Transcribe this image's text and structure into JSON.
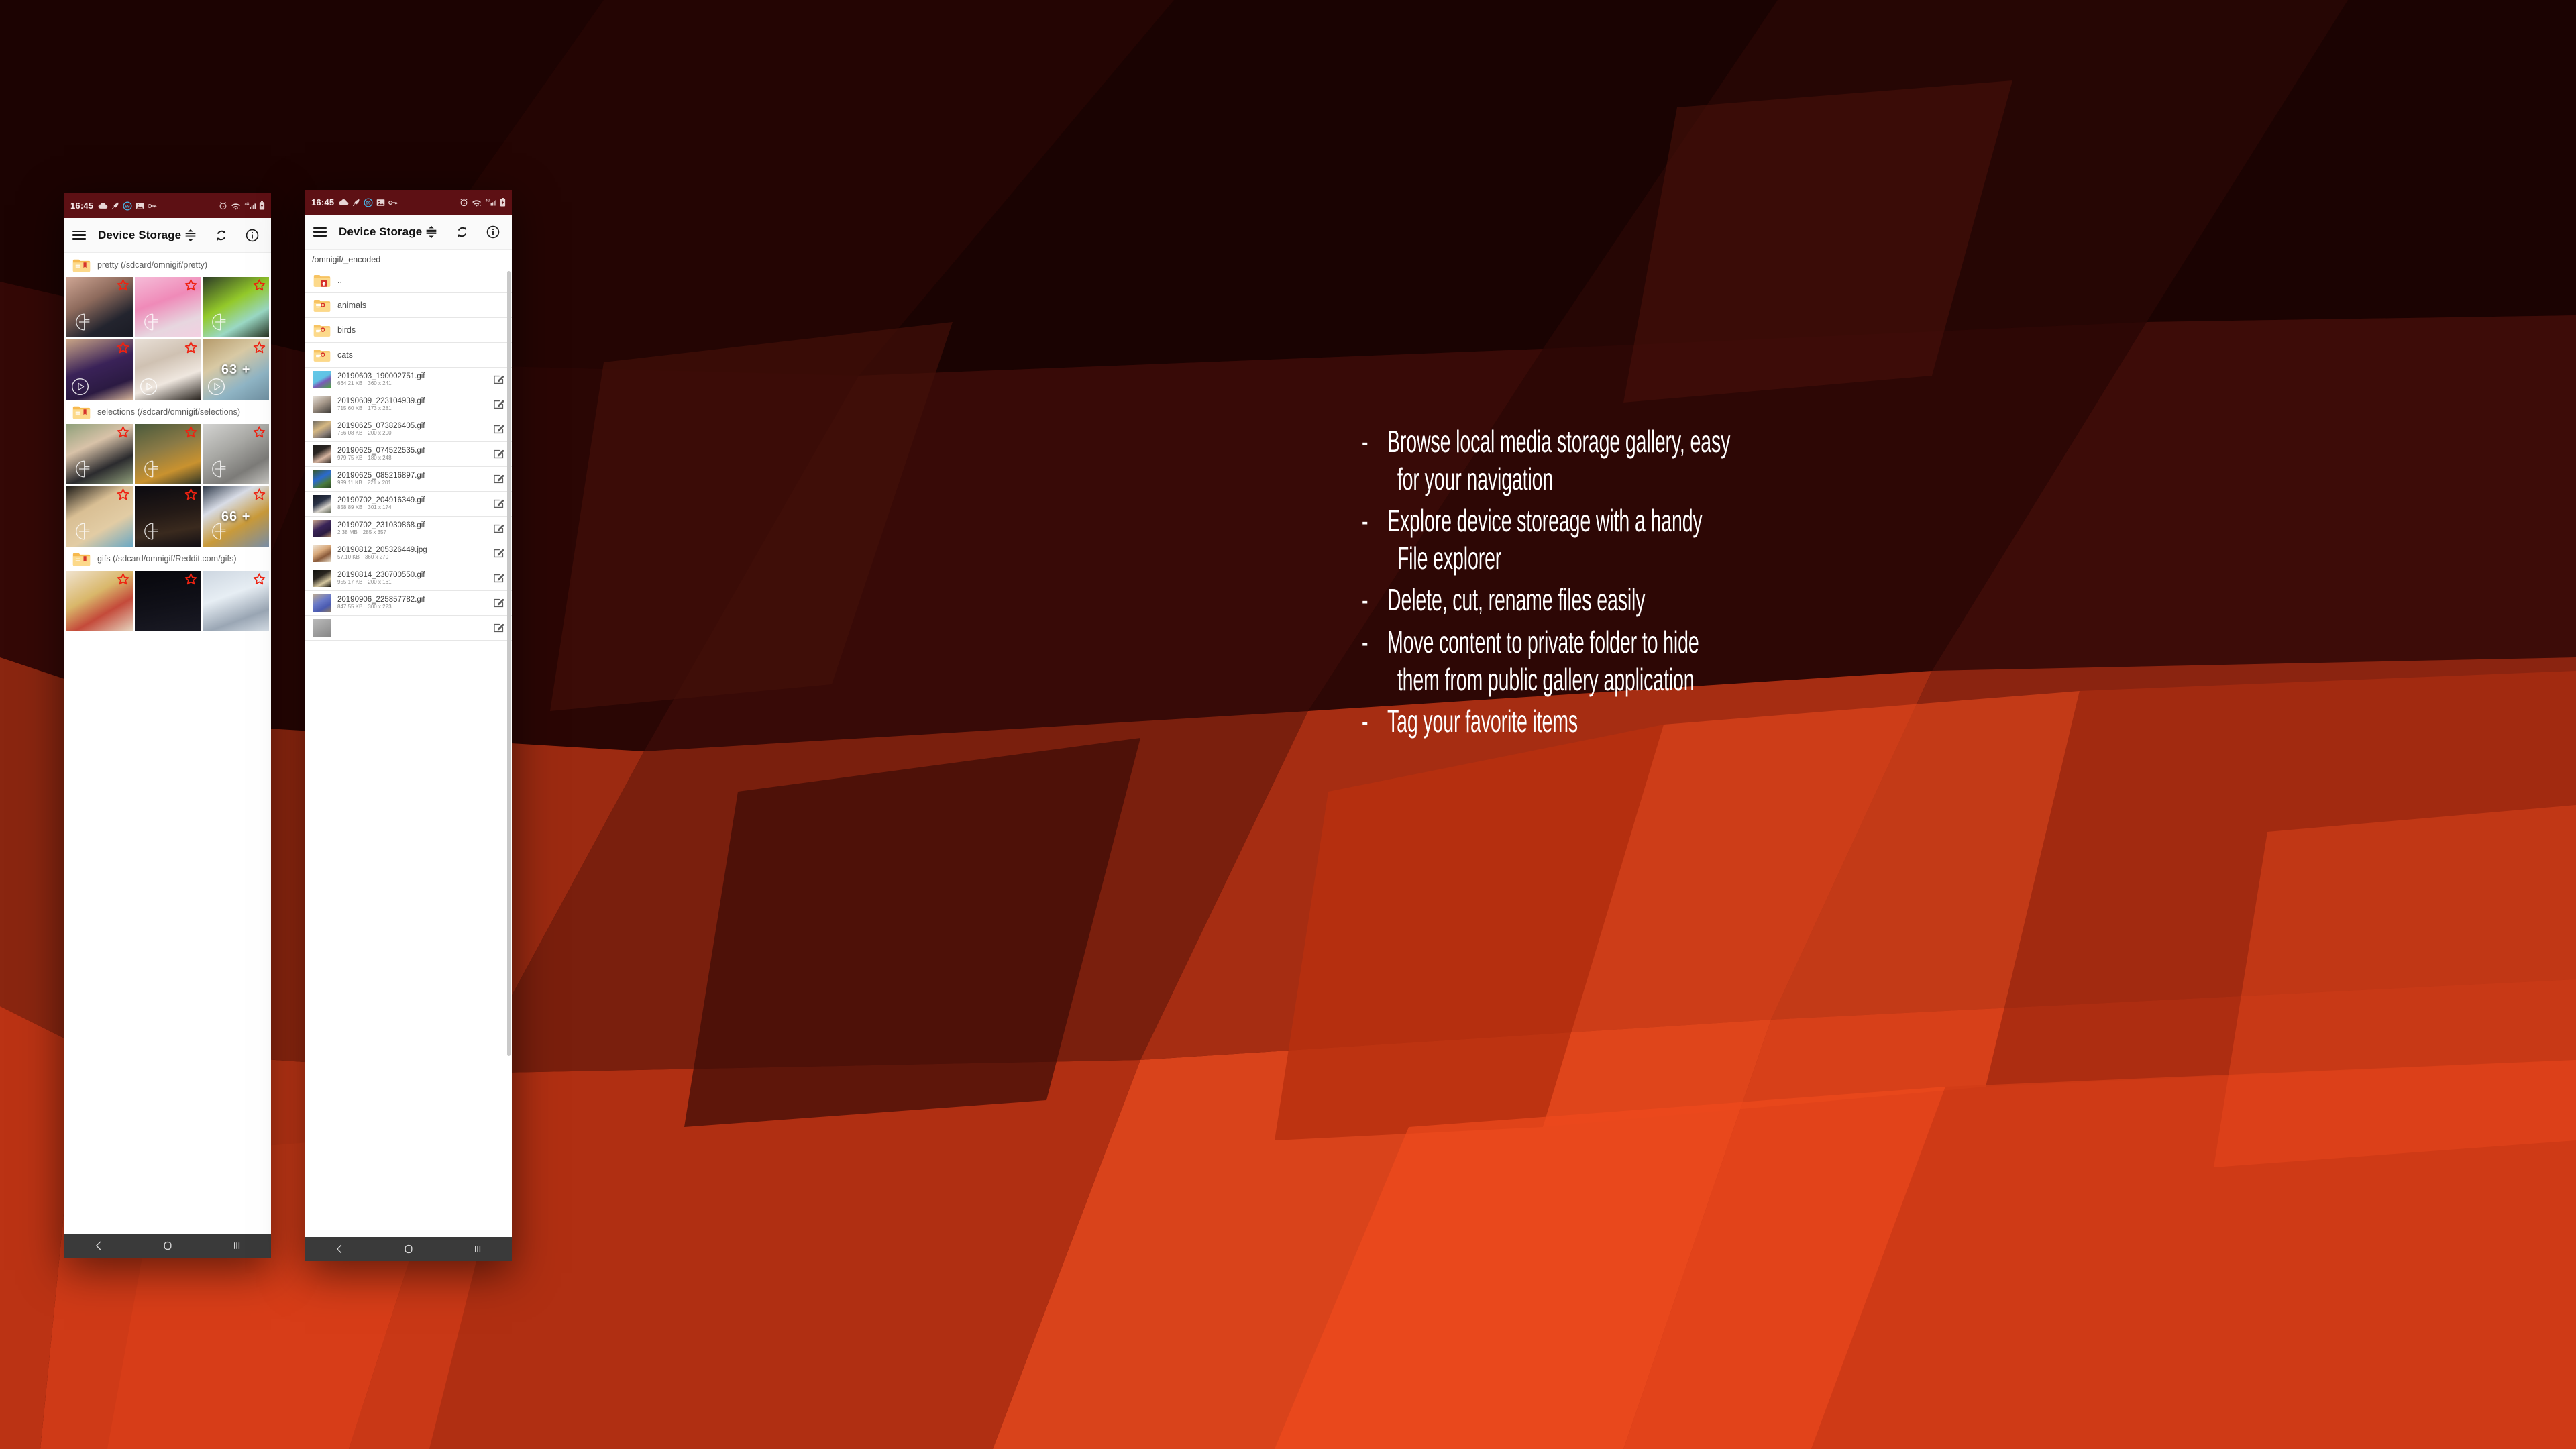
{
  "theme": {
    "statusbar_bg": "#5d1014",
    "appbar_bg": "#fafafa",
    "navbar_bg": "#3a3a3a",
    "folder_yellow": "#fbd27f",
    "star_red": "#ef2211",
    "bg_red_dark": "#3a0c07",
    "bg_red_bright": "#f03a16"
  },
  "statusbar": {
    "time": "16:45",
    "left_icons": [
      "cloud-icon",
      "rocket-icon",
      "badge-99-icon",
      "image-icon",
      "key-icon"
    ],
    "badge_text": "99",
    "right_icons": [
      "alarm-icon",
      "wifi-icon",
      "signal-4g-icon",
      "battery-charging-icon"
    ],
    "network_label": "4G"
  },
  "appbar": {
    "menu_icon": "hamburger-icon",
    "title": "Device Storage",
    "actions": [
      {
        "name": "sort-button",
        "icon": "sort-icon"
      },
      {
        "name": "refresh-button",
        "icon": "refresh-icon"
      },
      {
        "name": "info-button",
        "icon": "info-icon"
      }
    ]
  },
  "navbar": {
    "back_label": "back-icon",
    "home_label": "home-icon",
    "recents_label": "recents-icon"
  },
  "phone1": {
    "sections": [
      {
        "folder_label": "pretty (/sdcard/omnigif/pretty)",
        "tiles": [
          {
            "name": "tile-1",
            "starred": true,
            "overlay": "",
            "badge": "watermark",
            "tone": "t-skin-a"
          },
          {
            "name": "tile-2",
            "starred": true,
            "overlay": "",
            "badge": "watermark",
            "tone": "t-pink"
          },
          {
            "name": "tile-3",
            "starred": true,
            "overlay": "",
            "badge": "watermark",
            "tone": "t-green"
          },
          {
            "name": "tile-4",
            "starred": true,
            "overlay": "",
            "badge": "play",
            "tone": "t-purple"
          },
          {
            "name": "tile-5",
            "starred": true,
            "overlay": "",
            "badge": "play",
            "tone": "t-white"
          },
          {
            "name": "tile-6",
            "starred": true,
            "overlay": "63 +",
            "badge": "play",
            "tone": "t-straw"
          }
        ]
      },
      {
        "folder_label": "selections (/sdcard/omnigif/selections)",
        "tiles": [
          {
            "name": "tile-7",
            "starred": true,
            "overlay": "",
            "badge": "watermark",
            "tone": "t-park"
          },
          {
            "name": "tile-8",
            "starred": true,
            "overlay": "",
            "badge": "watermark",
            "tone": "t-dusk"
          },
          {
            "name": "tile-9",
            "starred": true,
            "overlay": "",
            "badge": "watermark",
            "tone": "t-grey"
          },
          {
            "name": "tile-10",
            "starred": true,
            "overlay": "",
            "badge": "watermark",
            "tone": "t-car"
          },
          {
            "name": "tile-11",
            "starred": true,
            "overlay": "",
            "badge": "watermark",
            "tone": "t-night"
          },
          {
            "name": "tile-12",
            "starred": true,
            "overlay": "66 +",
            "badge": "watermark",
            "tone": "t-toon"
          }
        ]
      },
      {
        "folder_label": "gifs (/sdcard/omnigif/Reddit.com/gifs)",
        "tiles": [
          {
            "name": "tile-13",
            "starred": true,
            "overlay": "",
            "badge": "",
            "tone": "t-cream"
          },
          {
            "name": "tile-14",
            "starred": true,
            "overlay": "",
            "badge": "",
            "tone": "t-dark"
          },
          {
            "name": "tile-15",
            "starred": true,
            "overlay": "",
            "badge": "",
            "tone": "t-snow"
          }
        ]
      }
    ]
  },
  "phone2": {
    "breadcrumb": "/omnigif/_encoded",
    "folders": [
      {
        "name": "folder-up",
        "label": "..",
        "icon": "folder-up-icon"
      },
      {
        "name": "folder-animals",
        "label": "animals",
        "icon": "folder-icon"
      },
      {
        "name": "folder-birds",
        "label": "birds",
        "icon": "folder-icon"
      },
      {
        "name": "folder-cats",
        "label": "cats",
        "icon": "folder-icon"
      }
    ],
    "files": [
      {
        "filename": "20190603_190002751.gif",
        "size": "664.21 KB",
        "dimensions": "360 x 241",
        "tone": "f-tom"
      },
      {
        "filename": "20190609_223104939.gif",
        "size": "715.60 KB",
        "dimensions": "173 x 281",
        "tone": "f-dog"
      },
      {
        "filename": "20190625_073826405.gif",
        "size": "756.08 KB",
        "dimensions": "200 x 200",
        "tone": "f-pug"
      },
      {
        "filename": "20190625_074522535.gif",
        "size": "979.75 KB",
        "dimensions": "180 x 248",
        "tone": "f-girl"
      },
      {
        "filename": "20190625_085216897.gif",
        "size": "999.11 KB",
        "dimensions": "221 x 201",
        "tone": "f-blue"
      },
      {
        "filename": "20190702_204916349.gif",
        "size": "858.89 KB",
        "dimensions": "301 x 174",
        "tone": "f-melon"
      },
      {
        "filename": "20190702_231030868.gif",
        "size": "2.38 MB",
        "dimensions": "285 x 357",
        "tone": "f-violet"
      },
      {
        "filename": "20190812_205326449.jpg",
        "size": "57.10 KB",
        "dimensions": "360 x 270",
        "tone": "f-bunny"
      },
      {
        "filename": "20190814_230700550.gif",
        "size": "955.17 KB",
        "dimensions": "200 x 161",
        "tone": "f-man"
      },
      {
        "filename": "20190906_225857782.gif",
        "size": "847.55 KB",
        "dimensions": "300 x 223",
        "tone": "f-tom2"
      }
    ],
    "edit_icon": "edit-pencil-icon"
  },
  "marketing": {
    "bullets": [
      {
        "dash": "-",
        "line1": "Browse local media storage gallery, easy",
        "line2": "for your navigation"
      },
      {
        "dash": "-",
        "line1": "Explore device storeage with a handy",
        "line2": "File explorer"
      },
      {
        "dash": "-",
        "line1": "Delete, cut, rename files easily",
        "line2": ""
      },
      {
        "dash": "-",
        "line1": "Move content to private folder to hide",
        "line2": "them from public gallery application"
      },
      {
        "dash": "-",
        "line1": "Tag your favorite items",
        "line2": ""
      }
    ]
  }
}
